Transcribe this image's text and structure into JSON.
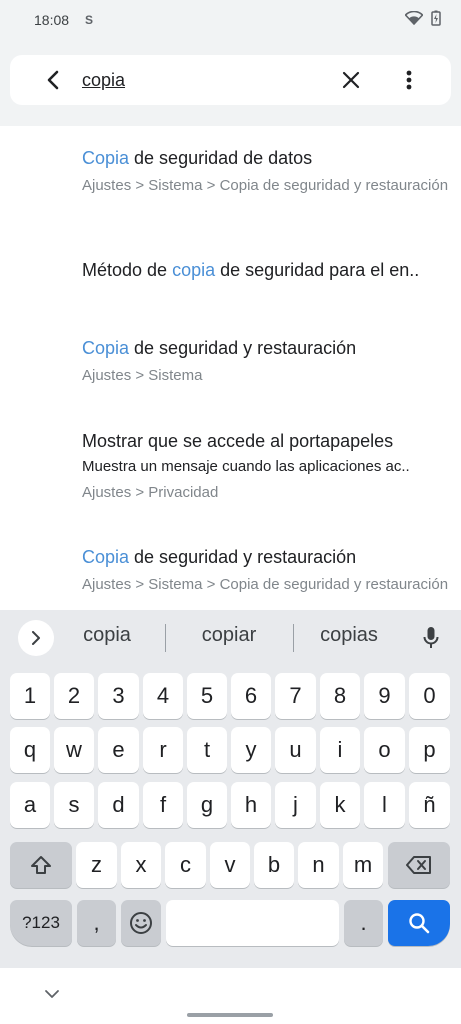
{
  "status_bar": {
    "time": "18:08",
    "notification_icon": "S"
  },
  "search": {
    "query": "copia"
  },
  "results": [
    {
      "title_parts": [
        {
          "text": "Copia",
          "highlight": true
        },
        {
          "text": " de seguridad de datos",
          "highlight": false
        }
      ],
      "summary": "",
      "path": "Ajustes > Sistema > Copia de seguridad y restauración"
    },
    {
      "title_parts": [
        {
          "text": "Método de ",
          "highlight": false
        },
        {
          "text": "copia",
          "highlight": true
        },
        {
          "text": " de seguridad para el en..",
          "highlight": false
        }
      ],
      "summary": "",
      "path": ""
    },
    {
      "title_parts": [
        {
          "text": "Copia",
          "highlight": true
        },
        {
          "text": " de seguridad y restauración",
          "highlight": false
        }
      ],
      "summary": "",
      "path": "Ajustes > Sistema"
    },
    {
      "title_parts": [
        {
          "text": "Mostrar que se accede al portapapeles",
          "highlight": false
        }
      ],
      "summary": "Muestra un mensaje cuando las aplicaciones ac..",
      "path": "Ajustes > Privacidad"
    },
    {
      "title_parts": [
        {
          "text": "Copia",
          "highlight": true
        },
        {
          "text": " de seguridad y restauración",
          "highlight": false
        }
      ],
      "summary": "",
      "path": "Ajustes > Sistema > Copia de seguridad y restauración"
    }
  ],
  "keyboard": {
    "suggestions": [
      "copia",
      "copiar",
      "copias"
    ],
    "rows": [
      [
        "1",
        "2",
        "3",
        "4",
        "5",
        "6",
        "7",
        "8",
        "9",
        "0"
      ],
      [
        "q",
        "w",
        "e",
        "r",
        "t",
        "y",
        "u",
        "i",
        "o",
        "p"
      ],
      [
        "a",
        "s",
        "d",
        "f",
        "g",
        "h",
        "j",
        "k",
        "l",
        "ñ"
      ],
      [
        "z",
        "x",
        "c",
        "v",
        "b",
        "n",
        "m"
      ]
    ],
    "symbols_label": "?123",
    "comma_label": ",",
    "period_label": ".",
    "accent_color": "#1a73e8",
    "highlight_color": "#4a8fd6"
  },
  "icons": {
    "status": [
      "notification-s-icon",
      "wifi-icon",
      "battery-charging-icon"
    ],
    "header": [
      "back-arrow-icon",
      "clear-icon",
      "more-vert-icon"
    ],
    "keyboard": [
      "expand-suggestions-icon",
      "mic-icon",
      "shift-icon",
      "backspace-icon",
      "emoji-icon",
      "search-icon"
    ],
    "nav": [
      "hide-keyboard-icon"
    ]
  }
}
